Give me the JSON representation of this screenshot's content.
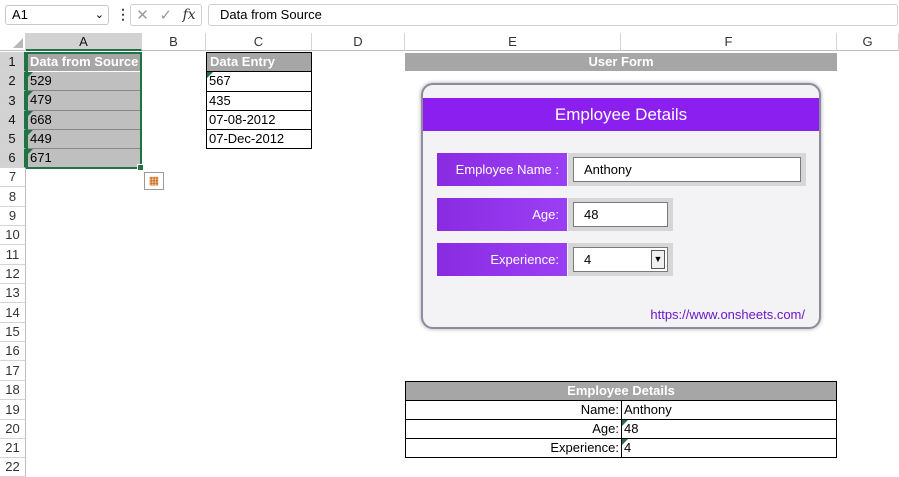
{
  "formula_bar": {
    "name_box": "A1",
    "dots": "⋮",
    "cancel_icon": "✕",
    "enter_icon": "✓",
    "fx_label": "fx",
    "content": "Data from Source"
  },
  "columns": [
    "A",
    "B",
    "C",
    "D",
    "E",
    "F",
    "G"
  ],
  "rows": [
    "1",
    "2",
    "3",
    "4",
    "5",
    "6",
    "7",
    "8",
    "9",
    "10",
    "11",
    "12",
    "13",
    "14",
    "15",
    "16",
    "17",
    "18",
    "19",
    "20",
    "21",
    "22"
  ],
  "col_a": {
    "header": "Data from Source",
    "values": [
      "529",
      "479",
      "668",
      "449",
      "671"
    ]
  },
  "col_c": {
    "header": "Data Entry",
    "values": [
      "567",
      "435",
      "07-08-2012",
      "07-Dec-2012"
    ]
  },
  "user_form": {
    "section_title": "User Form",
    "title": "Employee Details",
    "name_label": "Employee Name :",
    "name_value": "Anthony",
    "age_label": "Age:",
    "age_value": "48",
    "experience_label": "Experience:",
    "experience_value": "4",
    "link": "https://www.onsheets.com/"
  },
  "employee_table": {
    "title": "Employee Details",
    "rows": [
      {
        "label": "Name:",
        "value": "Anthony"
      },
      {
        "label": "Age:",
        "value": "48"
      },
      {
        "label": "Experience:",
        "value": "4"
      }
    ]
  },
  "colors": {
    "excel_green": "#217346",
    "form_purple": "#8b1ff0",
    "header_gray": "#a6a6a6",
    "link_purple": "#6a19c9"
  }
}
